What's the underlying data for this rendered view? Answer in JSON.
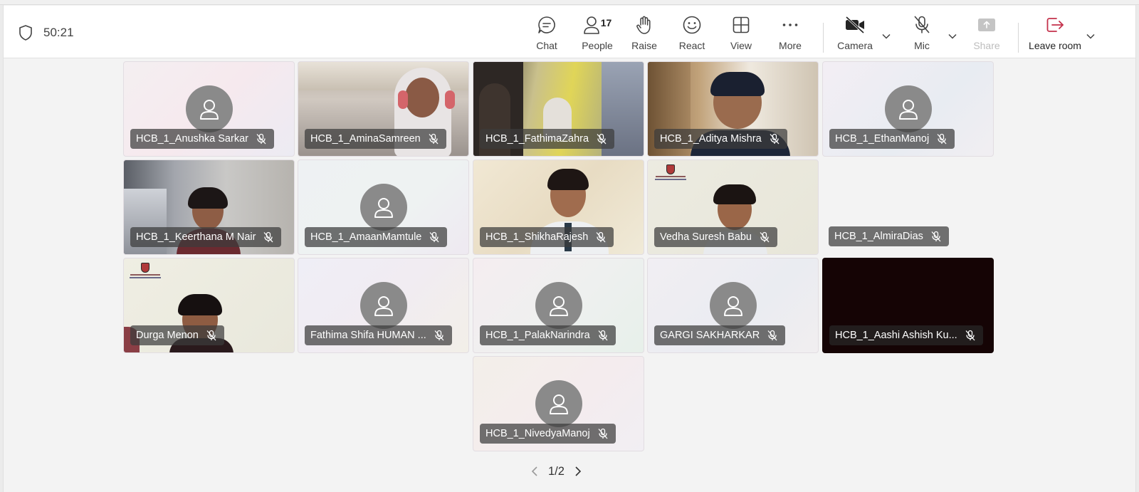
{
  "meeting": {
    "timer": "50:21"
  },
  "toolbar": {
    "chat_label": "Chat",
    "people_label": "People",
    "people_count": "17",
    "raise_label": "Raise",
    "react_label": "React",
    "view_label": "View",
    "more_label": "More",
    "camera_label": "Camera",
    "mic_label": "Mic",
    "share_label": "Share",
    "leave_label": "Leave room",
    "leave_color": "#c4314b"
  },
  "participants": [
    {
      "name": "HCB_1_Anushka Sarkar",
      "video": false
    },
    {
      "name": "HCB_1_AminaSamreen",
      "video": true
    },
    {
      "name": "HCB_1_FathimaZahra",
      "video": true
    },
    {
      "name": "HCB_1_Aditya Mishra",
      "video": true
    },
    {
      "name": "HCB_1_EthanManoj",
      "video": false
    },
    {
      "name": "HCB_1_Keerthana M Nair",
      "video": true
    },
    {
      "name": "HCB_1_AmaanMamtule",
      "video": false
    },
    {
      "name": "HCB_1_ShikhaRajesh",
      "video": true
    },
    {
      "name": "Vedha Suresh Babu",
      "video": true
    },
    {
      "name": "HCB_1_AlmiraDias",
      "video": false
    },
    {
      "name": "Durga Menon",
      "video": true
    },
    {
      "name": "Fathima Shifa HUMAN ...",
      "video": false
    },
    {
      "name": "HCB_1_PalakNarindra",
      "video": false
    },
    {
      "name": "GARGI SAKHARKAR",
      "video": false
    },
    {
      "name": "HCB_1_Aashi Ashish Ku...",
      "video": true
    },
    {
      "name": "HCB_1_NivedyaManoj",
      "video": false
    }
  ],
  "pager": {
    "text": "1/2"
  }
}
